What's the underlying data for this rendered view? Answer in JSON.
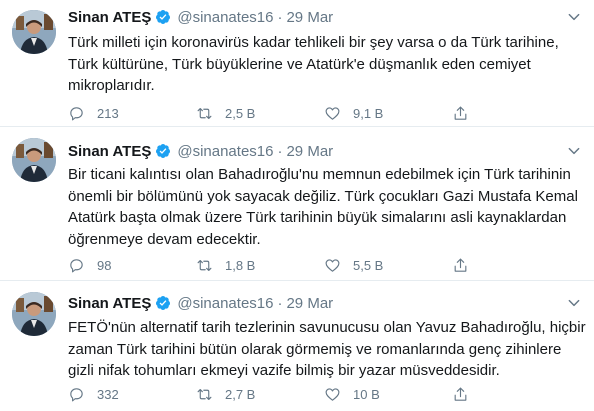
{
  "tweets": [
    {
      "author_name": "Sinan ATEŞ",
      "handle": "@sinanates16",
      "separator": "·",
      "date": "29 Mar",
      "text_lines": [
        "Türk milleti için koronavirüs kadar tehlikeli bir şey varsa o da  Türk tarihine,",
        "Türk kültürüne, Türk büyüklerine ve Atatürk'e düşmanlık eden cemiyet",
        "mikroplarıdır."
      ],
      "replies": "213",
      "retweets": "2,5 B",
      "likes": "9,1 B"
    },
    {
      "author_name": "Sinan ATEŞ",
      "handle": "@sinanates16",
      "separator": "·",
      "date": "29 Mar",
      "text_lines": [
        "Bir ticani kalıntısı olan Bahadıroğlu'nu memnun edebilmek için Türk tarihinin",
        "önemli bir bölümünü yok sayacak değiliz. Türk çocukları Gazi Mustafa Kemal",
        "Atatürk başta olmak üzere Türk tarihinin büyük simalarını asli kaynaklardan",
        "öğrenmeye devam edecektir."
      ],
      "replies": "98",
      "retweets": "1,8 B",
      "likes": "5,5 B"
    },
    {
      "author_name": "Sinan ATEŞ",
      "handle": "@sinanates16",
      "separator": "·",
      "date": "29 Mar",
      "text_lines": [
        "FETÖ'nün alternatif tarih tezlerinin savunucusu olan Yavuz Bahadıroğlu, hiçbir",
        "zaman Türk tarihini bütün olarak görmemiş ve  romanlarında genç zihinlere",
        "gizli nifak tohumları ekmeyi vazife bilmiş bir yazar müsveddesidir."
      ],
      "replies": "332",
      "retweets": "2,7 B",
      "likes": "10 B"
    }
  ],
  "icons": {
    "verified": "verified-badge-icon",
    "caret": "chevron-down-icon",
    "reply": "reply-icon",
    "retweet": "retweet-icon",
    "like": "heart-icon",
    "share": "share-icon"
  },
  "colors": {
    "text": "#14171a",
    "secondary": "#657786",
    "verified_blue": "#1da1f2",
    "divider": "#e6ecf0"
  }
}
